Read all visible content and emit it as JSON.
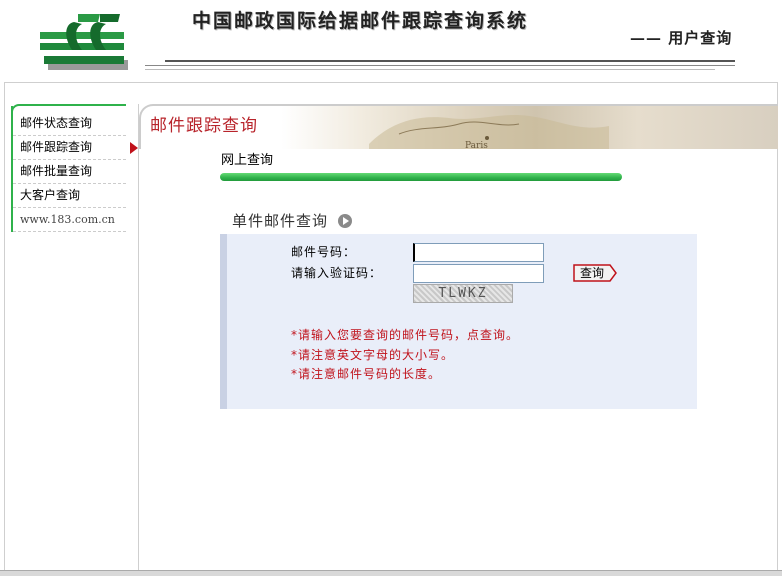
{
  "header": {
    "site_title": "中国邮政国际给据邮件跟踪查询系统",
    "subtitle": "—— 用户查询"
  },
  "sidebar": {
    "items": [
      {
        "label": "邮件状态查询"
      },
      {
        "label": "邮件跟踪查询",
        "active": true
      },
      {
        "label": "邮件批量查询"
      },
      {
        "label": "大客户查询"
      },
      {
        "label": "www.183.com.cn"
      }
    ]
  },
  "banner": {
    "title": "邮件跟踪查询",
    "map_text": "Paris"
  },
  "section": {
    "title": "网上查询"
  },
  "single_query": {
    "title": "单件邮件查询",
    "fields": {
      "mail_number_label": "邮件号码：",
      "mail_number_value": "",
      "captcha_label": "请输入验证码：",
      "captcha_value": ""
    },
    "captcha_text": "TLWKZ",
    "query_button": "查询",
    "notes": [
      "*请输入您要查询的邮件号码，点查询。",
      "*请注意英文字母的大小写。",
      "*请注意邮件号码的长度。"
    ]
  },
  "colors": {
    "accent_green": "#2fb24b",
    "accent_red": "#c0121b",
    "panel_bg": "#e9eef9"
  }
}
